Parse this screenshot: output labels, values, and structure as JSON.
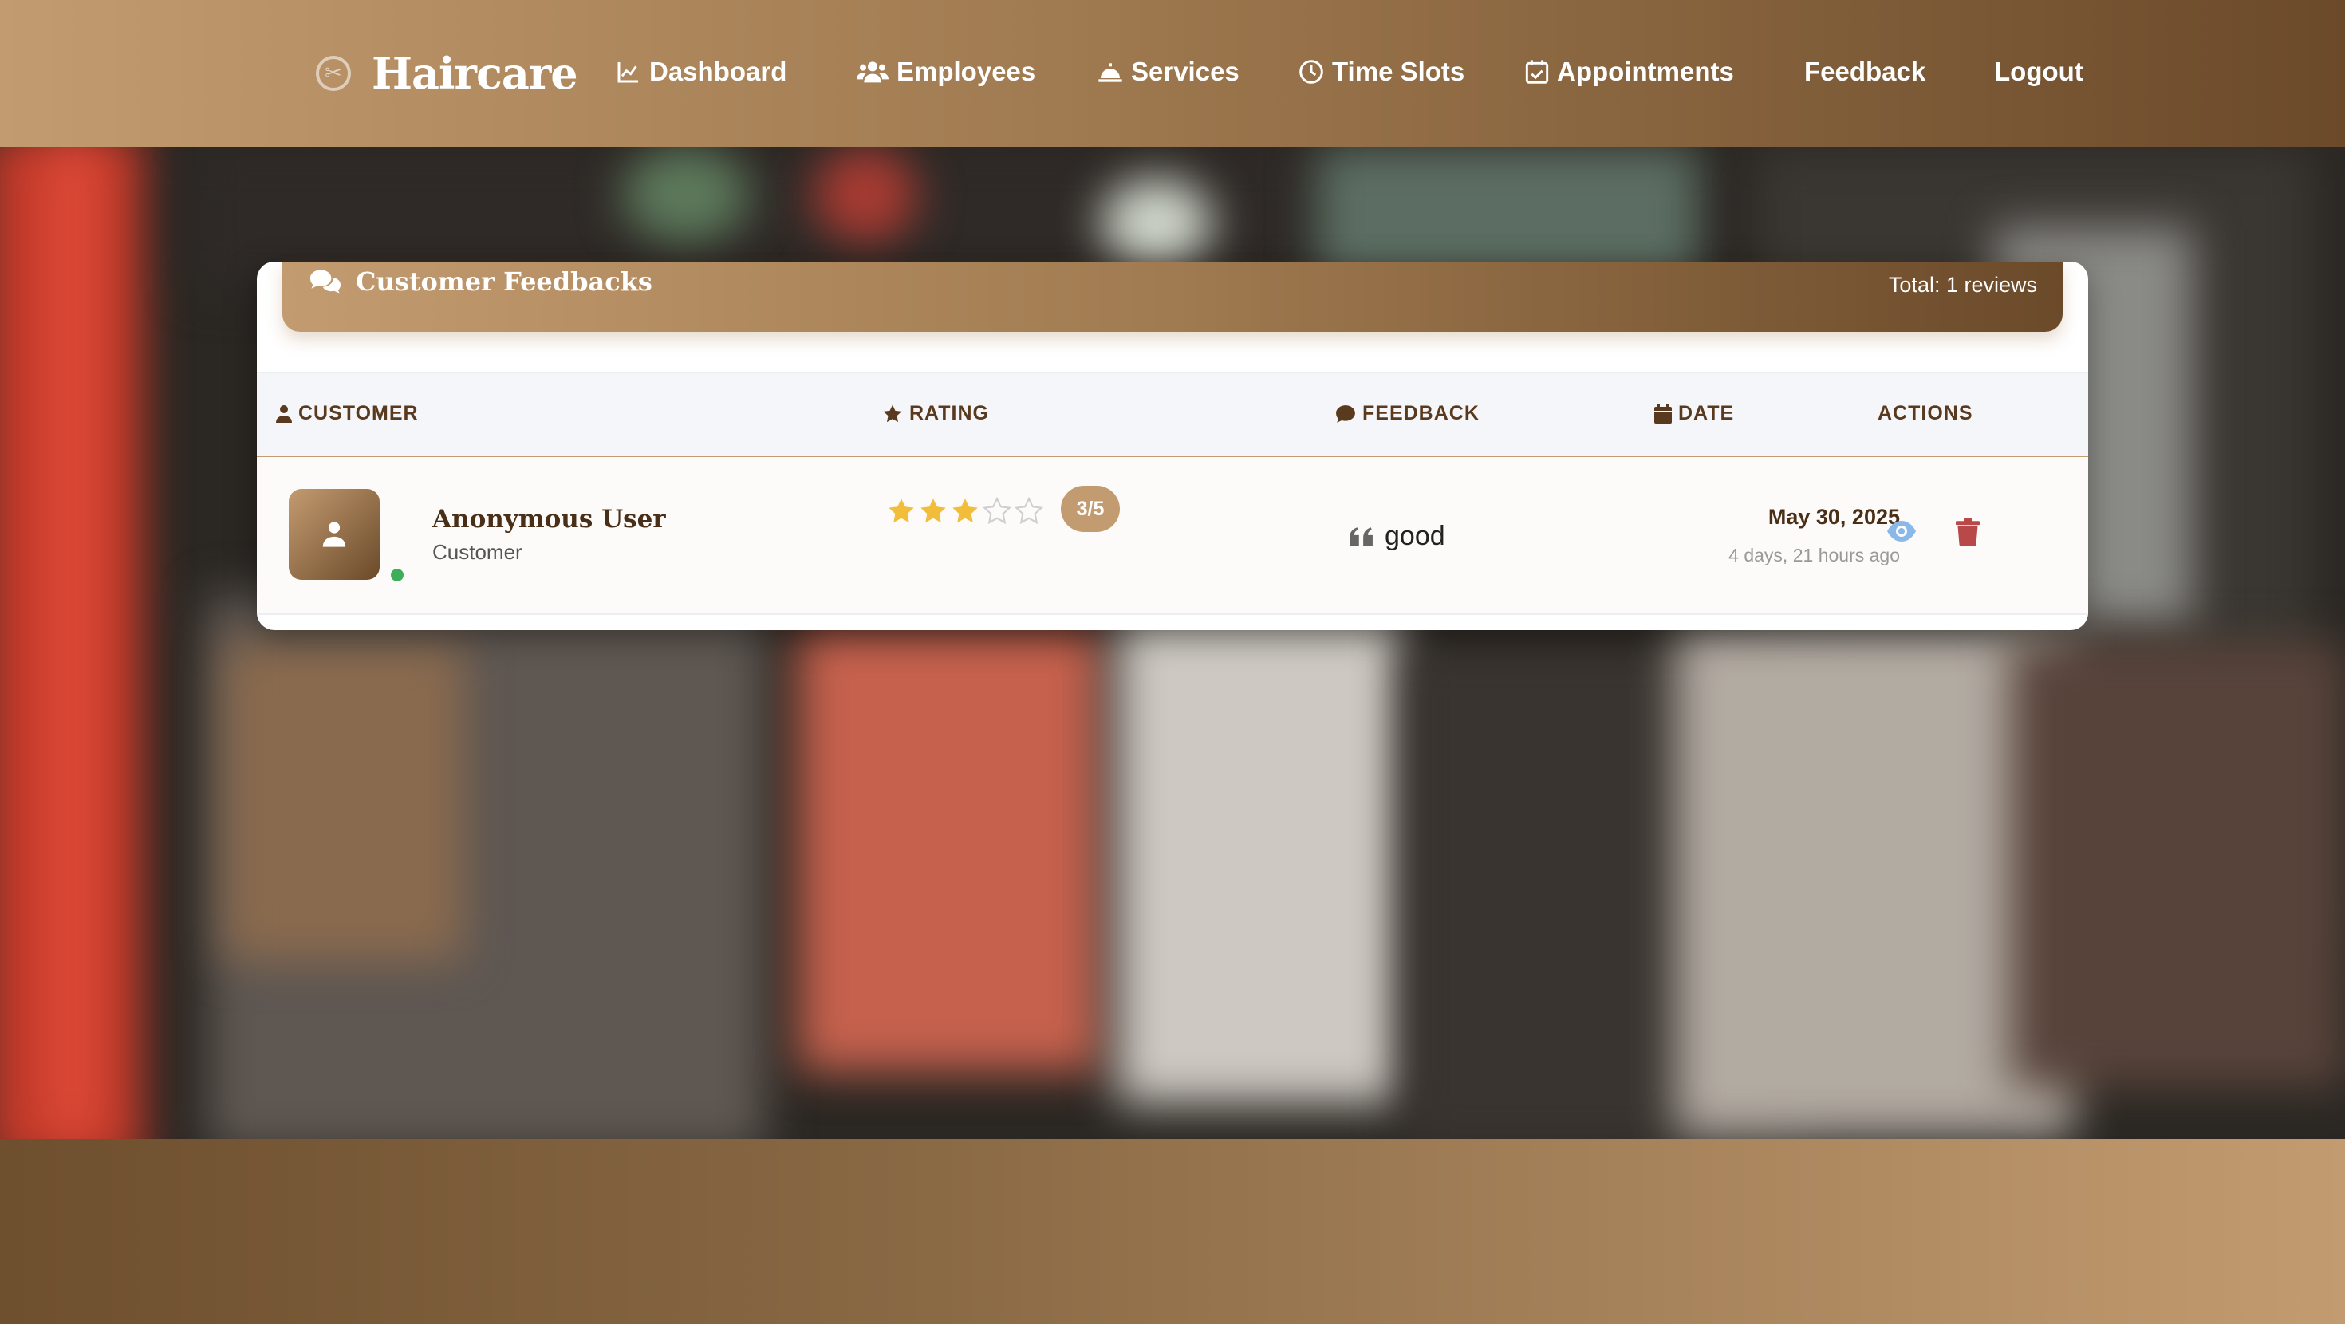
{
  "brand": {
    "name": "Haircare"
  },
  "nav": {
    "dashboard": "Dashboard",
    "employees": "Employees",
    "services": "Services",
    "time_slots": "Time Slots",
    "appointments": "Appointments",
    "feedback": "Feedback",
    "logout": "Logout"
  },
  "card": {
    "title": "Customer Feedbacks",
    "total": "Total: 1 reviews"
  },
  "table": {
    "headers": {
      "customer": "CUSTOMER",
      "rating": "RATING",
      "feedback": "FEEDBACK",
      "date": "DATE",
      "actions": "ACTIONS"
    },
    "rows": [
      {
        "name": "Anonymous User",
        "role": "Customer",
        "rating": 3,
        "rating_max": 5,
        "rating_label": "3/5",
        "feedback": "good",
        "date": "May 30, 2025",
        "date_relative": "4 days, 21 hours ago"
      }
    ]
  },
  "colors": {
    "accent": "#c39b70",
    "accent_dark": "#6b4a2a",
    "star": "#f3bd3c",
    "view": "#8ab8e8",
    "delete": "#b94848",
    "online": "#3fae5a"
  }
}
